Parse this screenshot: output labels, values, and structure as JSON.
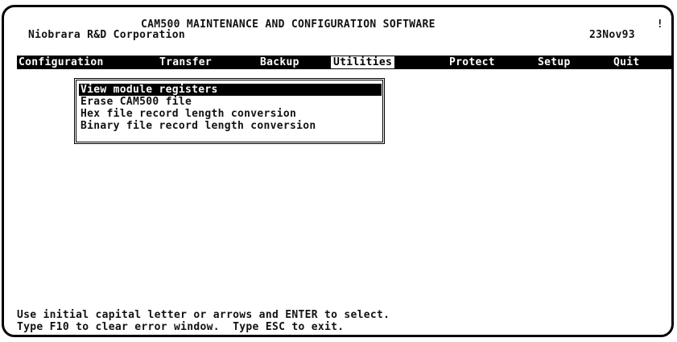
{
  "header": {
    "title": "CAM500 MAINTENANCE AND CONFIGURATION SOFTWARE",
    "company": "Niobrara R&D Corporation",
    "date": "23Nov93",
    "corner_mark": "!"
  },
  "menubar": {
    "items": [
      {
        "label": "Configuration"
      },
      {
        "label": "Transfer"
      },
      {
        "label": "Backup"
      },
      {
        "label": "Utilities"
      },
      {
        "label": "Protect"
      },
      {
        "label": "Setup"
      },
      {
        "label": "Quit"
      }
    ],
    "active_item": "Utilities"
  },
  "utilities_menu": {
    "items": [
      {
        "label": "View module registers"
      },
      {
        "label": "Erase CAM500 file"
      },
      {
        "label": "Hex file record length conversion"
      },
      {
        "label": "Binary file record length conversion"
      }
    ],
    "selected_item": "View module registers"
  },
  "status": {
    "line1": "Use initial capital letter or arrows and ENTER to select.",
    "line2": "Type F10 to clear error window.  Type ESC to exit."
  },
  "colors": {
    "background": "#ffffff",
    "foreground": "#111111",
    "highlight": "#000000"
  }
}
